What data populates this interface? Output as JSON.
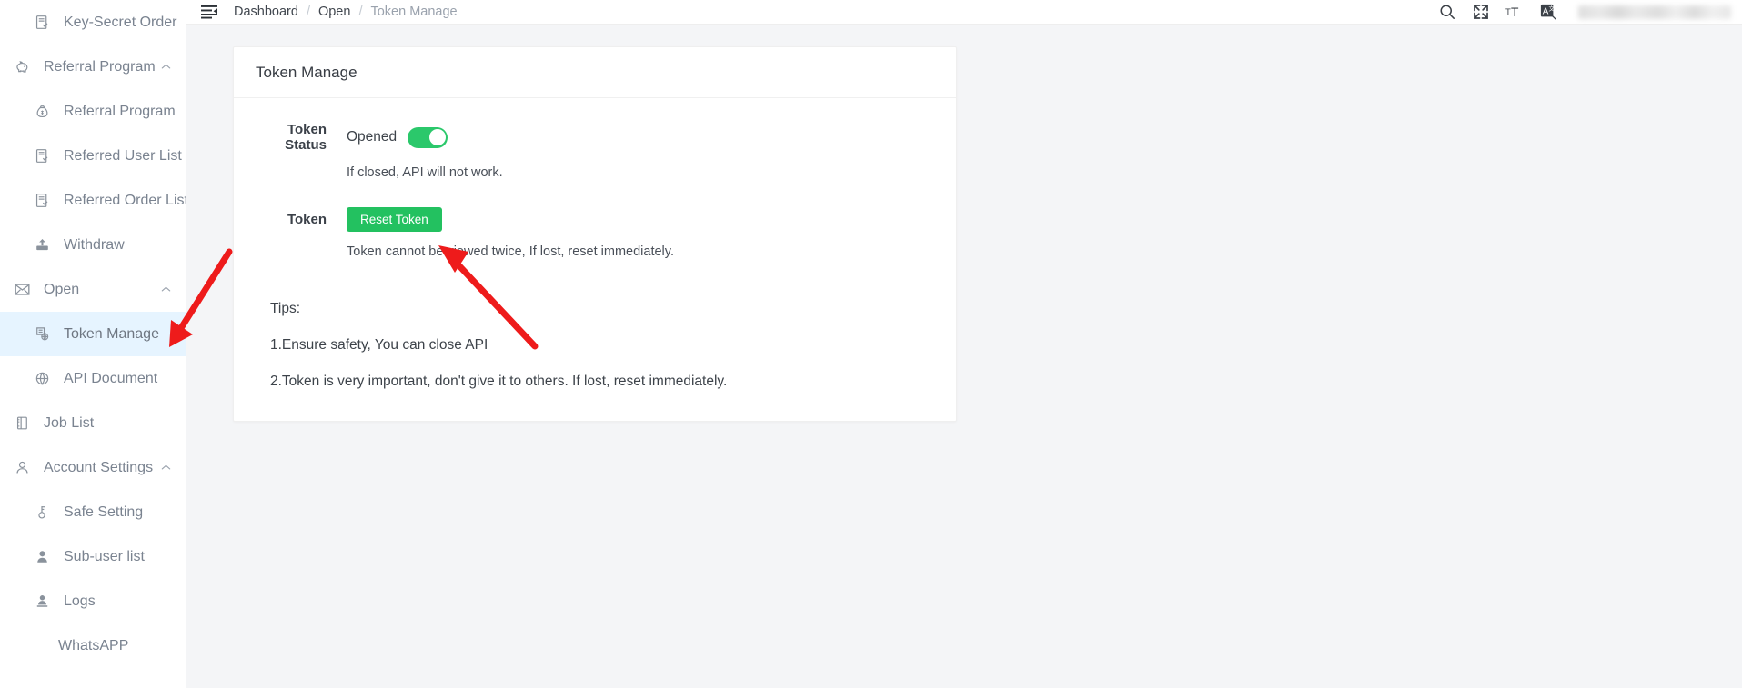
{
  "sidebar": {
    "items": [
      {
        "label": "Key-Secret Order",
        "icon": "document-check-icon",
        "level": "child",
        "active": false,
        "expandable": false
      },
      {
        "label": "Referral Program",
        "icon": "piggy-bank-icon",
        "level": "group",
        "active": false,
        "expandable": true,
        "expanded": true
      },
      {
        "label": "Referral Program",
        "icon": "money-bag-icon",
        "level": "child",
        "active": false,
        "expandable": false
      },
      {
        "label": "Referred User List",
        "icon": "document-check-icon",
        "level": "child",
        "active": false,
        "expandable": false
      },
      {
        "label": "Referred Order List",
        "icon": "document-check-icon",
        "level": "child",
        "active": false,
        "expandable": false
      },
      {
        "label": "Withdraw",
        "icon": "withdraw-icon",
        "level": "child",
        "active": false,
        "expandable": false
      },
      {
        "label": "Open",
        "icon": "mail-icon",
        "level": "group",
        "active": false,
        "expandable": true,
        "expanded": true
      },
      {
        "label": "Token Manage",
        "icon": "token-globe-icon",
        "level": "child",
        "active": true,
        "expandable": false
      },
      {
        "label": "API Document",
        "icon": "globe-icon",
        "level": "child",
        "active": false,
        "expandable": false
      },
      {
        "label": "Job List",
        "icon": "notebook-icon",
        "level": "plain",
        "active": false,
        "expandable": false
      },
      {
        "label": "Account Settings",
        "icon": "user-outline-icon",
        "level": "plain",
        "active": false,
        "expandable": true,
        "expanded": true
      },
      {
        "label": "Safe Setting",
        "icon": "key-icon",
        "level": "child",
        "active": false,
        "expandable": false
      },
      {
        "label": "Sub-user list",
        "icon": "user-solid-icon",
        "level": "child",
        "active": false,
        "expandable": false
      },
      {
        "label": "Logs",
        "icon": "user-stamp-icon",
        "level": "child",
        "active": false,
        "expandable": false
      },
      {
        "label": "WhatsAPP",
        "icon": "",
        "level": "nolabelicon",
        "active": false,
        "expandable": false
      }
    ]
  },
  "topbar": {
    "menu_toggle_icon": "hamburger-collapse-icon",
    "breadcrumb": [
      {
        "label": "Dashboard",
        "current": false
      },
      {
        "label": "Open",
        "current": false
      },
      {
        "label": "Token Manage",
        "current": true
      }
    ],
    "separator": "/",
    "actions": [
      {
        "name": "search-icon",
        "glyph": "search"
      },
      {
        "name": "fullscreen-icon",
        "glyph": "fullscreen"
      },
      {
        "name": "font-size-icon",
        "glyph": "fontsize"
      },
      {
        "name": "translate-icon",
        "glyph": "translate"
      }
    ]
  },
  "card": {
    "title": "Token Manage",
    "token_status": {
      "label": "Token Status",
      "state_text": "Opened",
      "switch_on": true,
      "helper": "If closed, API will not work."
    },
    "token": {
      "label": "Token",
      "button_label": "Reset Token",
      "helper": "Token cannot be viewed twice, If lost, reset immediately."
    },
    "tips": {
      "heading": "Tips:",
      "lines": [
        "1.Ensure safety, You can close API",
        "2.Token is very important, don't give it to others. If lost, reset immediately."
      ]
    }
  },
  "colors": {
    "accent_green": "#23c160",
    "switch_green": "#2bc86b",
    "active_nav_bg": "#e6f4ff",
    "annotation_red": "#ee1b1b",
    "page_bg": "#f4f5f7"
  },
  "annotations": [
    {
      "name": "arrow-to-token-manage-nav",
      "color": "#ee1b1b"
    },
    {
      "name": "arrow-to-reset-token-button",
      "color": "#ee1b1b"
    }
  ]
}
